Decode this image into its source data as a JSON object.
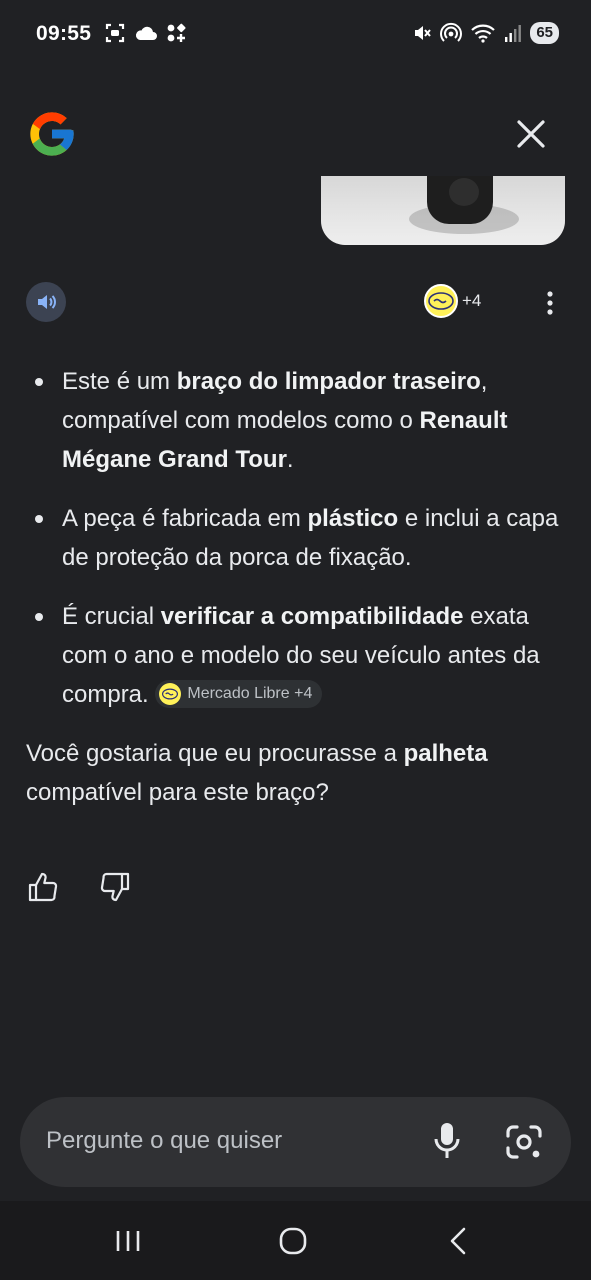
{
  "status_bar": {
    "time": "09:55",
    "battery": "65",
    "left_icons": [
      "screenshot-icon",
      "cloud-icon",
      "apps-icon"
    ],
    "right_icons": [
      "mute-icon",
      "hotspot-icon",
      "wifi-icon",
      "signal-icon"
    ]
  },
  "header": {
    "logo": "google-g-logo",
    "close_icon": "close-icon"
  },
  "actions": {
    "speaker_icon": "speaker-icon",
    "sources_count": "+4",
    "more_icon": "more-vert-icon"
  },
  "response": {
    "bullets": [
      {
        "t1": "Este é um ",
        "b1": "braço do limpador traseiro",
        "t2": ", compatível com modelos como o ",
        "b2": "Renault Mégane Grand Tour",
        "t3": "."
      },
      {
        "t1": "A peça é fabricada em ",
        "b1": "plástico",
        "t2": " e inclui a capa de proteção da porca de fixação."
      },
      {
        "t1": "É crucial ",
        "b1": "verificar a compatibilidade",
        "t2": " exata com o ano e modelo do seu veículo antes da compra. ",
        "source_chip": "Mercado Libre +4"
      }
    ],
    "followup": {
      "t1": "Você gostaria que eu procurasse a ",
      "b1": "palheta",
      "t2": " compatível para este braço?"
    }
  },
  "feedback": {
    "like_icon": "thumbs-up-icon",
    "dislike_icon": "thumbs-down-icon"
  },
  "input": {
    "placeholder": "Pergunte o que quiser",
    "mic_icon": "mic-icon",
    "lens_icon": "lens-camera-icon"
  },
  "nav": {
    "recents_icon": "recents-icon",
    "home_icon": "home-icon",
    "back_icon": "back-icon"
  },
  "colors": {
    "background": "#202124",
    "input_bar": "#303134",
    "speaker_bg": "#3c4352",
    "mercado_yellow": "#fff159"
  }
}
